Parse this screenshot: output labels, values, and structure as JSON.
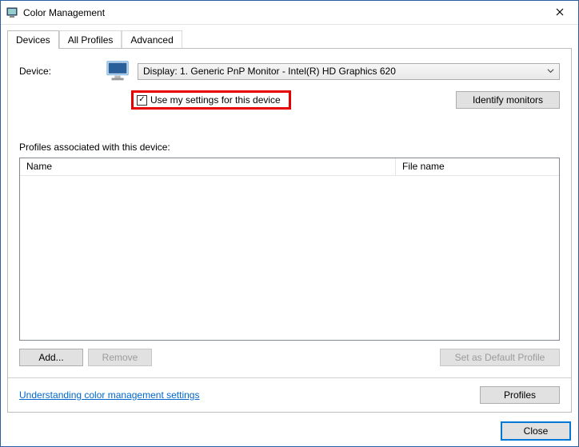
{
  "window": {
    "title": "Color Management"
  },
  "tabs": {
    "devices": "Devices",
    "all_profiles": "All Profiles",
    "advanced": "Advanced"
  },
  "device": {
    "label": "Device:",
    "selected": "Display: 1. Generic PnP Monitor - Intel(R) HD Graphics 620"
  },
  "checkbox": {
    "use_settings": "Use my settings for this device",
    "checked_glyph": "✓"
  },
  "buttons": {
    "identify": "Identify monitors",
    "add": "Add...",
    "remove": "Remove",
    "set_default": "Set as Default Profile",
    "profiles": "Profiles",
    "close": "Close"
  },
  "profiles": {
    "label": "Profiles associated with this device:",
    "columns": {
      "name": "Name",
      "file": "File name"
    }
  },
  "link": {
    "understanding": "Understanding color management settings"
  }
}
